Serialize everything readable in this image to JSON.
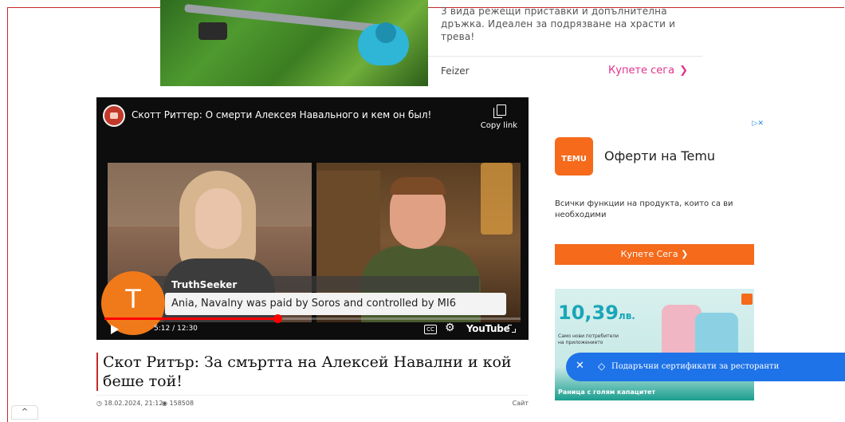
{
  "top_ad": {
    "text": "3 вида режещи приставки и допълнителна дръжка. Идеален за подрязване на храсти и трева!",
    "brand": "Feizer",
    "cta": "Купете сега",
    "chev": "❯"
  },
  "video": {
    "title": "Скотт Риттер: О смерти Алексея Навального и кем он был!",
    "copy_label": "Copy link",
    "comment_author": "TruthSeeker",
    "comment_text": "Ania, Navalny was paid by Soros and controlled by MI6",
    "avatar_letter": "T",
    "time": "5:12 / 12:30",
    "progress": 0.416,
    "cc_label": "CC",
    "gear": "⚙",
    "youtube_label": "YouTube",
    "accent": "#ff0000"
  },
  "article": {
    "title": "Скот Ритър: За смъртта на Алексей Навални и кой беше той!",
    "date": "18.02.2024, 21:12",
    "views": "158508",
    "right_label": "Сайт"
  },
  "right_ad": {
    "ad_marks": "▷✕",
    "logo_text": "TEMU",
    "title": "Оферти на Temu",
    "description": "Всички функции на продукта, които са ви необходими",
    "button": "Купете Сега ❯",
    "price": "10,39",
    "price_unit": "лв.",
    "banner_sub": "Само нови потребители на приложението",
    "banner_bottom": "Раница с голям капацитет",
    "brand_color": "#f56a1b"
  },
  "notification": {
    "close": "✕",
    "tag_icon": "◇",
    "text": "Подаръчни сертификати за ресторанти",
    "color": "#1e73e8"
  },
  "scroll_up": "^"
}
